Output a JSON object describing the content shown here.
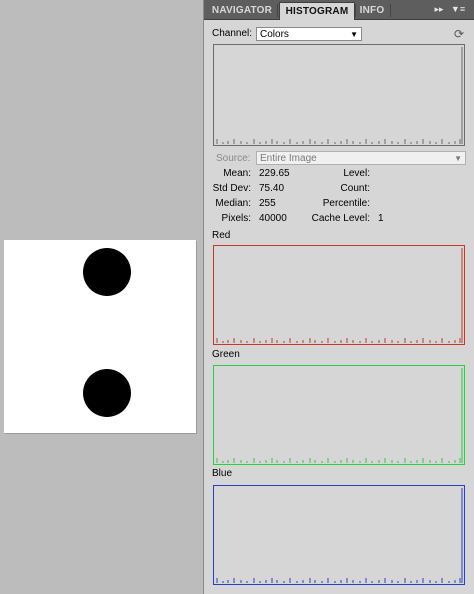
{
  "tabs": [
    {
      "label": "NAVIGATOR"
    },
    {
      "label": "HISTOGRAM"
    },
    {
      "label": "INFO"
    }
  ],
  "channel": {
    "label": "Channel:",
    "value": "Colors"
  },
  "source": {
    "label": "Source:",
    "value": "Entire Image"
  },
  "stats": {
    "mean_label": "Mean:",
    "mean": "229.65",
    "stddev_label": "Std Dev:",
    "stddev": "75.40",
    "median_label": "Median:",
    "median": "255",
    "pixels_label": "Pixels:",
    "pixels": "40000",
    "level_label": "Level:",
    "count_label": "Count:",
    "percentile_label": "Percentile:",
    "cache_label": "Cache Level:",
    "cache": "1"
  },
  "channels": {
    "red": "Red",
    "green": "Green",
    "blue": "Blue"
  },
  "colors": {
    "composite": "#6a6a6a",
    "red": "#c0392b",
    "green": "#2ecc40",
    "blue": "#2a3ec2"
  },
  "icons": {
    "collapse": "double-right-arrow-icon",
    "menu": "panel-menu-icon",
    "refresh": "refresh-icon",
    "dropdown": "chevron-down-icon"
  }
}
